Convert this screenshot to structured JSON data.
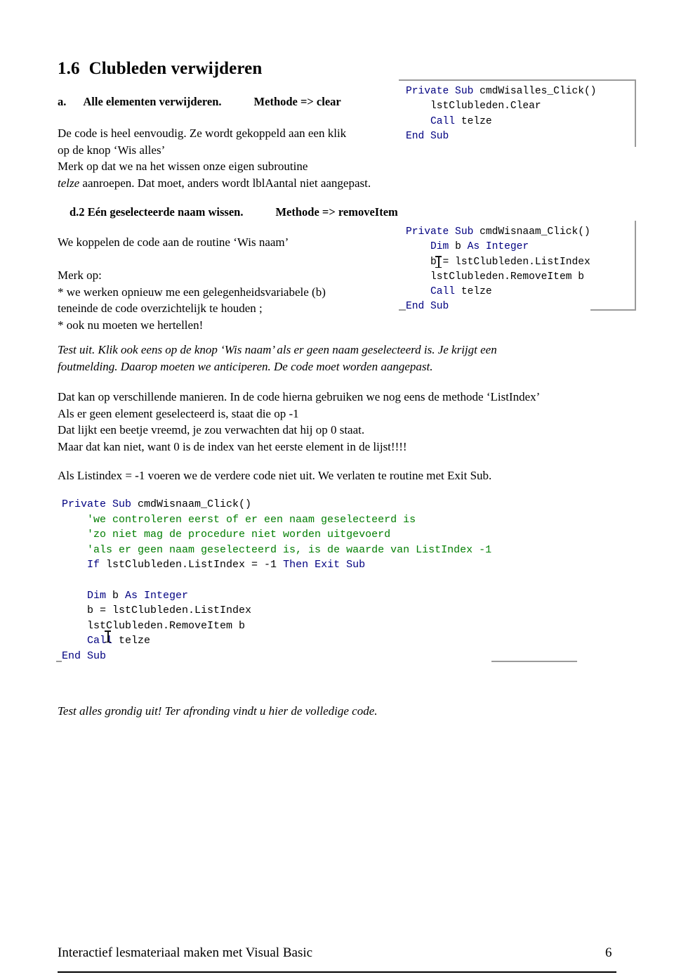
{
  "document": {
    "heading": {
      "number": "1.6",
      "title": "Clubleden verwijderen"
    },
    "section_a": {
      "label": "a.",
      "title": "Alle elementen verwijderen.",
      "method": "Methode => clear",
      "body_line1": "De code is heel eenvoudig. Ze wordt gekoppeld aan een klik",
      "body_line2": "op de knop ‘Wis alles’",
      "body_line3": "Merk op dat we na het wissen onze eigen subroutine",
      "body_line4_italic": "telze",
      "body_line4_rest": " aanroepen. Dat moet, anders wordt lblAantal niet aangepast."
    },
    "section_d2": {
      "label": "d.2",
      "title": "Eén geselecteerde naam wissen.",
      "method": "Methode => removeItem",
      "intro": "We koppelen de code aan de routine ‘Wis naam’",
      "note_header": "Merk op:",
      "note_line1": "* we werken opnieuw me een gelegenheidsvariabele (b)",
      "note_line2": "teneinde de code overzichtelijk te houden ;",
      "note_line3": "* ook nu moeten we hertellen!"
    },
    "test_note": {
      "line1": "Test uit. Klik ook eens op de knop ‘Wis naam’ als er geen naam geselecteerd is. Je krijgt een",
      "line2": "foutmelding. Daarop moeten we anticiperen. De code moet worden aangepast."
    },
    "explanation": {
      "line1": "Dat kan op verschillende manieren. In de code hierna gebruiken we nog eens de methode ‘ListIndex’",
      "line2": "Als er geen element geselecteerd is, staat die op -1",
      "line3": "Dat lijkt een beetje vreemd, je zou verwachten dat hij op 0 staat.",
      "line4": "Maar dat kan niet, want 0 is de index van het eerste element in de lijst!!!!",
      "line5": "Als Listindex = -1  voeren we de verdere code niet uit. We verlaten te routine met   Exit Sub."
    },
    "closing_note": "Test alles grondig uit! Ter afronding vindt u hier de volledige code.",
    "footer": {
      "text": "Interactief lesmateriaal maken met Visual Basic",
      "page_number": "6"
    },
    "code_blocks": {
      "block1": {
        "line1_kw": "Private Sub ",
        "line1_pl": "cmdWisalles_Click()",
        "line2": "    lstClubleden.Clear",
        "line3_kw": "    Call ",
        "line3_pl": "telze",
        "line4_kw": "End Sub"
      },
      "block2": {
        "line1_kw": "Private Sub ",
        "line1_pl": "cmdWisnaam_Click()",
        "line2_kw1": "    Dim ",
        "line2_pl1": "b ",
        "line2_kw2": "As Integer",
        "line3": "    b = lstClubleden.ListIndex",
        "line4": "    lstClubleden.RemoveItem b",
        "line5_kw": "    Call ",
        "line5_pl": "telze",
        "line6_kw": "End Sub"
      },
      "block3": {
        "line1_kw": "Private Sub ",
        "line1_pl": "cmdWisnaam_Click()",
        "line2_cm": "    'we controleren eerst of er een naam geselecteerd is",
        "line3_cm": "    'zo niet mag de procedure niet worden uitgevoerd",
        "line4_cm": "    'als er geen naam geselecteerd is, is de waarde van ListIndex -1",
        "line5_kw1": "    If ",
        "line5_pl1": "lstClubleden.ListIndex = -1 ",
        "line5_kw2": "Then Exit Sub",
        "line6_kw1": "    Dim ",
        "line6_pl1": "b ",
        "line6_kw2": "As Integer",
        "line7": "    b = lstClubleden.ListIndex",
        "line8": "    lstClubleden.RemoveItem b",
        "line9_kw": "    Call ",
        "line9_pl": "telze",
        "line10_kw": "End Sub"
      }
    }
  },
  "colors": {
    "keyword": "#000080",
    "comment": "#007d00",
    "plain": "#000000",
    "rule": "#9a9a9a"
  }
}
